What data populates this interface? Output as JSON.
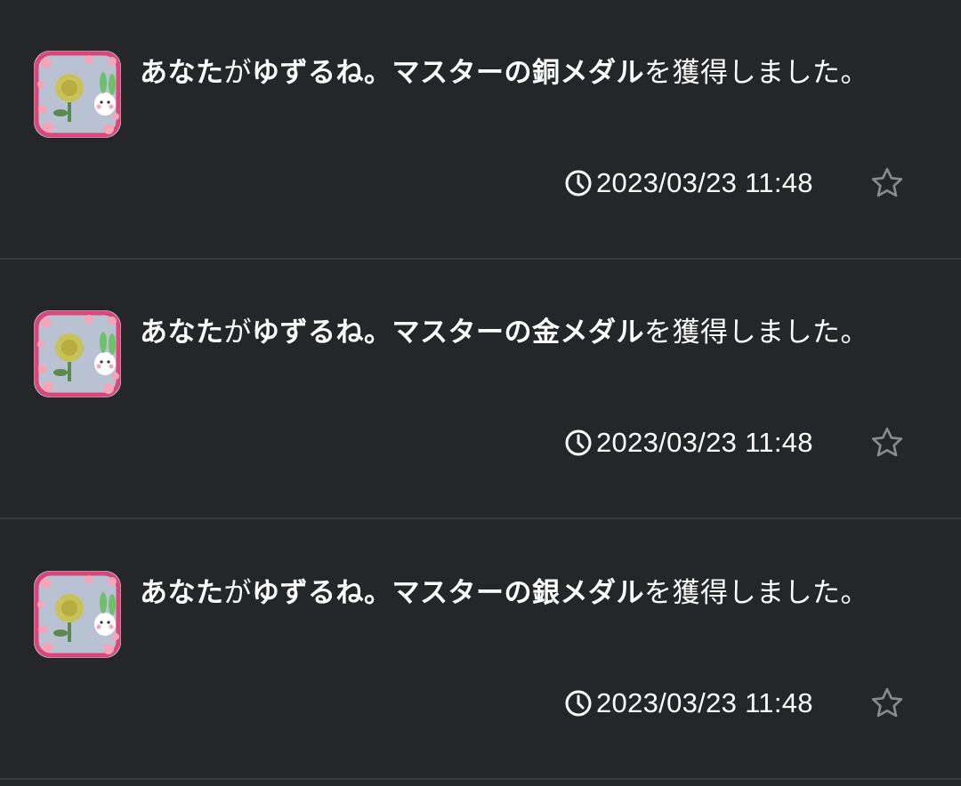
{
  "notifications": [
    {
      "avatar": "avatar-icon",
      "message": {
        "part1": "あなた",
        "part2": "が",
        "part3": "ゆずるね。マスターの銅メダル",
        "part4": "を獲得しました。"
      },
      "timestamp": "2023/03/23 11:48",
      "favorited": false
    },
    {
      "avatar": "avatar-icon",
      "message": {
        "part1": "あなた",
        "part2": "が",
        "part3": "ゆずるね。マスターの金メダル",
        "part4": "を獲得しました。"
      },
      "timestamp": "2023/03/23 11:48",
      "favorited": false
    },
    {
      "avatar": "avatar-icon",
      "message": {
        "part1": "あなた",
        "part2": "が",
        "part3": "ゆずるね。マスターの銀メダル",
        "part4": "を獲得しました。"
      },
      "timestamp": "2023/03/23 11:48",
      "favorited": false
    }
  ],
  "icons": {
    "clock": "clock-icon",
    "star": "star-outline-icon"
  },
  "colors": {
    "background": "#252627",
    "divider": "#3a3b3c",
    "text": "#ffffff",
    "star": "#8a8a8a",
    "avatar_frame": "#d94677"
  }
}
